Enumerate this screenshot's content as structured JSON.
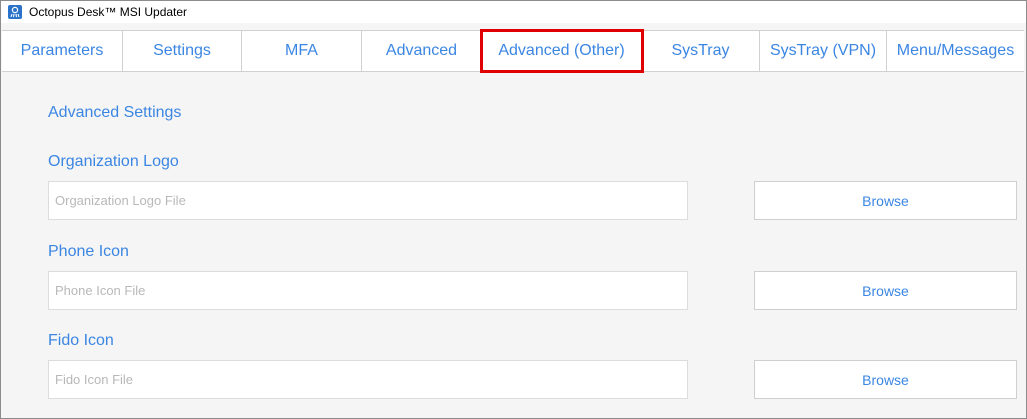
{
  "window": {
    "title": "Octopus Desk™ MSI Updater",
    "icon": "octopus-app-icon"
  },
  "tabs": [
    {
      "label": "Parameters"
    },
    {
      "label": "Settings"
    },
    {
      "label": "MFA"
    },
    {
      "label": "Advanced"
    },
    {
      "label": "Advanced (Other)",
      "selected": true
    },
    {
      "label": "SysTray"
    },
    {
      "label": "SysTray (VPN)"
    },
    {
      "label": "Menu/Messages"
    }
  ],
  "colors": {
    "accent": "#3b86e3",
    "highlight": "#e00000"
  },
  "page": {
    "section_title": "Advanced Settings",
    "fields": [
      {
        "label": "Organization Logo",
        "placeholder": "Organization Logo File",
        "button": "Browse"
      },
      {
        "label": "Phone Icon",
        "placeholder": "Phone Icon File",
        "button": "Browse"
      },
      {
        "label": "Fido Icon",
        "placeholder": "Fido Icon File",
        "button": "Browse"
      }
    ]
  }
}
